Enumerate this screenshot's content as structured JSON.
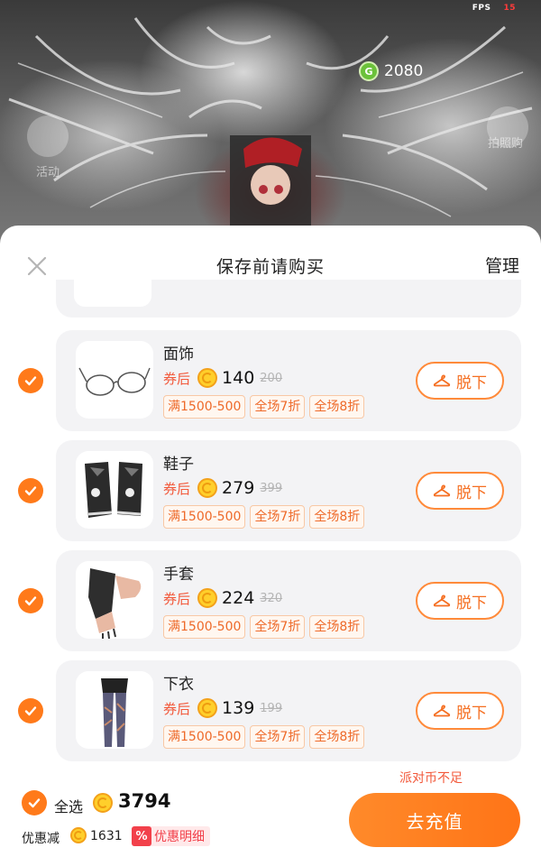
{
  "hud": {
    "fps_label": "FPS",
    "fps_value": "15",
    "coin_balance": "2080",
    "event_label": "活动",
    "right_label": "拍照购"
  },
  "sheet": {
    "title": "保存前请购买",
    "manage_label": "管理"
  },
  "items": [
    {
      "name": "面饰",
      "after_coupon": "券后",
      "price": "140",
      "original": "200",
      "tags": [
        "满1500-500",
        "全场7折",
        "全场8折"
      ],
      "remove_label": "脱下",
      "icon": "glasses"
    },
    {
      "name": "鞋子",
      "after_coupon": "券后",
      "price": "279",
      "original": "399",
      "tags": [
        "满1500-500",
        "全场7折",
        "全场8折"
      ],
      "remove_label": "脱下",
      "icon": "boots"
    },
    {
      "name": "手套",
      "after_coupon": "券后",
      "price": "224",
      "original": "320",
      "tags": [
        "满1500-500",
        "全场7折",
        "全场8折"
      ],
      "remove_label": "脱下",
      "icon": "gloves"
    },
    {
      "name": "下衣",
      "after_coupon": "券后",
      "price": "139",
      "original": "199",
      "tags": [
        "满1500-500",
        "全场7折",
        "全场8折"
      ],
      "remove_label": "脱下",
      "icon": "leggings"
    }
  ],
  "footer": {
    "insufficient_text": "派对币不足",
    "select_all_label": "全选",
    "total": "3794",
    "discount_label": "优惠减",
    "discount_value": "1631",
    "detail_icon": "%",
    "detail_label": "优惠明细",
    "recharge_label": "去充值"
  },
  "colors": {
    "accent": "#ff7a1a",
    "discount_red": "#f2583a",
    "tag_border": "#f8c8a5"
  }
}
